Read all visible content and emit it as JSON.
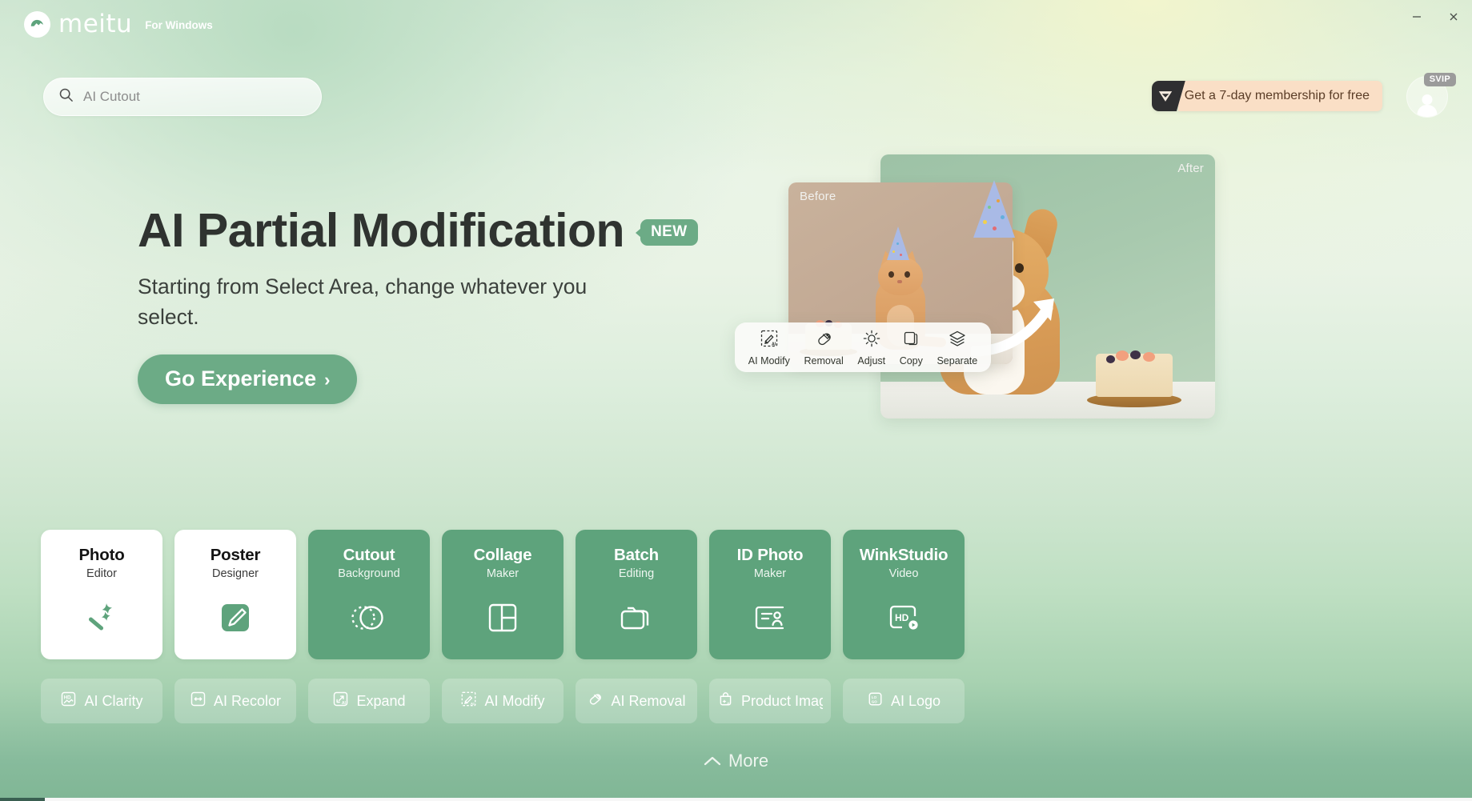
{
  "app": {
    "brand_name": "meitu",
    "brand_subtitle": "For Windows",
    "logo_icon": "meitu-logo-icon"
  },
  "window_controls": {
    "minimize_label": "—",
    "minimize_icon": "minimize-icon",
    "close_label": "✕",
    "close_icon": "close-icon"
  },
  "search": {
    "icon": "search-icon",
    "value": "AI Cutout",
    "placeholder": "AI Cutout"
  },
  "membership": {
    "icon": "diamond-icon",
    "label": "Get a 7-day membership for free",
    "badge_bg": "#2f2f31",
    "body_bg": "#fadfc6",
    "text_color": "#5b3d27"
  },
  "account": {
    "avatar_icon": "user-avatar-icon",
    "vip_badge": "SVIP"
  },
  "hero": {
    "title": "AI Partial Modification",
    "badge": "NEW",
    "subtitle": "Starting from Select Area, change whatever you select.",
    "cta_label": "Go Experience",
    "cta_chevron": "›",
    "accent_color": "#6cab86"
  },
  "showcase": {
    "before_label": "Before",
    "after_label": "After",
    "arrow_icon": "curved-arrow-icon",
    "tools": [
      {
        "label": "AI Modify",
        "icon": "ai-modify-icon"
      },
      {
        "label": "Removal",
        "icon": "eraser-icon"
      },
      {
        "label": "Adjust",
        "icon": "brightness-icon"
      },
      {
        "label": "Copy",
        "icon": "copy-icon"
      },
      {
        "label": "Separate",
        "icon": "layers-icon"
      }
    ]
  },
  "feature_cards": [
    {
      "title": "Photo",
      "subtitle": "Editor",
      "style": "light",
      "icon": "magic-wand-icon"
    },
    {
      "title": "Poster",
      "subtitle": "Designer",
      "style": "light",
      "icon": "pencil-square-icon"
    },
    {
      "title": "Cutout",
      "subtitle": "Background",
      "style": "green",
      "icon": "cutout-circle-icon"
    },
    {
      "title": "Collage",
      "subtitle": "Maker",
      "style": "green",
      "icon": "collage-grid-icon"
    },
    {
      "title": "Batch",
      "subtitle": "Editing",
      "style": "green",
      "icon": "folder-icon"
    },
    {
      "title": "ID Photo",
      "subtitle": "Maker",
      "style": "green",
      "icon": "id-card-icon"
    },
    {
      "title": "WinkStudio",
      "subtitle": "Video",
      "style": "green",
      "icon": "hd-video-icon"
    }
  ],
  "quick_tools": [
    {
      "label": "AI Clarity",
      "icon": "hd-image-icon"
    },
    {
      "label": "AI Recolor",
      "icon": "recolor-icon"
    },
    {
      "label": "Expand",
      "icon": "expand-ai-icon"
    },
    {
      "label": "AI Modify",
      "icon": "ai-modify-icon"
    },
    {
      "label": "AI Removal",
      "icon": "eraser-icon"
    },
    {
      "label": "Product Imag",
      "icon": "product-bag-ai-icon"
    },
    {
      "label": "AI Logo",
      "icon": "logo-box-icon"
    }
  ],
  "more": {
    "label": "More",
    "icon": "chevron-up-icon"
  },
  "colors": {
    "brand_green": "#5ea37c",
    "accent_green": "#6cab86",
    "page_top": "#cfe6d2",
    "page_bottom": "#80b695"
  }
}
